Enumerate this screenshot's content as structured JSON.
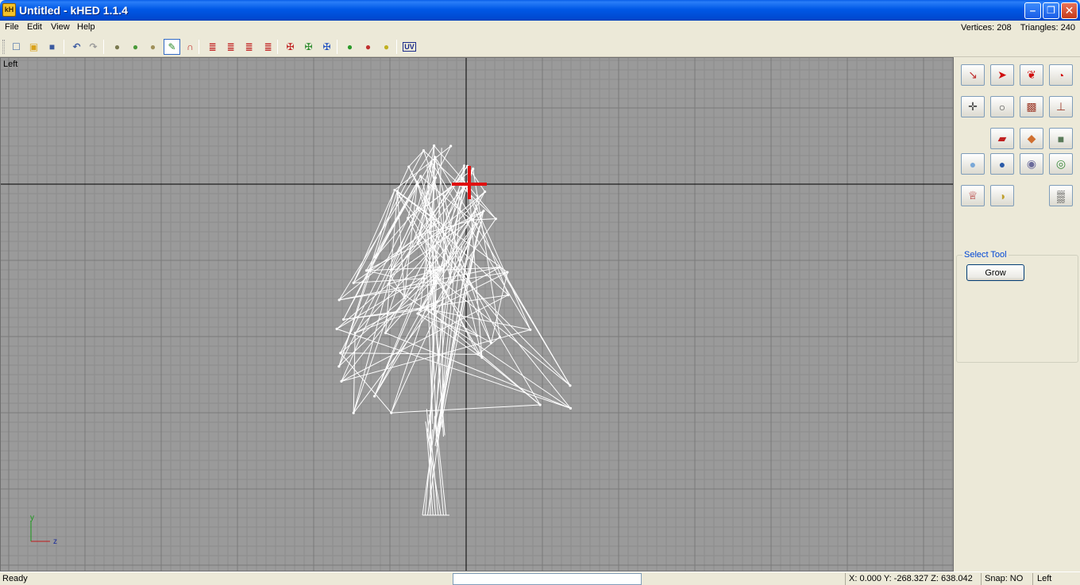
{
  "window": {
    "title": "Untitled - kHED 1.1.4",
    "icon_label": "kH",
    "minimize_glyph": "‒",
    "maximize_glyph": "❐",
    "close_glyph": "✕"
  },
  "menu": {
    "items": [
      "File",
      "Edit",
      "View",
      "Help"
    ]
  },
  "stats": {
    "vertices": "Vertices: 208",
    "triangles": "Triangles: 240"
  },
  "toolbar": {
    "buttons": [
      {
        "icon": "new-file-icon",
        "glyph": "☐",
        "color": "#4a6fa8"
      },
      {
        "icon": "open-folder-icon",
        "glyph": "▣",
        "color": "#d9a21b"
      },
      {
        "icon": "save-icon",
        "glyph": "■",
        "color": "#3b5aa0"
      },
      {
        "icon": "undo-icon",
        "glyph": "↶",
        "color": "#3b5aa0"
      },
      {
        "icon": "redo-icon",
        "glyph": "↷",
        "color": "#9a9a9a"
      },
      {
        "icon": "import-icon",
        "glyph": "●",
        "color": "#7a7a50"
      },
      {
        "icon": "export-icon",
        "glyph": "●",
        "color": "#4a9a3a"
      },
      {
        "icon": "merge-icon",
        "glyph": "●",
        "color": "#a0905a"
      },
      {
        "icon": "weld-tool-icon",
        "glyph": "✎",
        "color": "#2a8a2a"
      },
      {
        "icon": "magnet-icon",
        "glyph": "∩",
        "color": "#c02020"
      },
      {
        "icon": "flip-x-icon",
        "glyph": "≣",
        "color": "#c02020"
      },
      {
        "icon": "flip-y-icon",
        "glyph": "≣",
        "color": "#c02020"
      },
      {
        "icon": "flip-z-icon",
        "glyph": "≣",
        "color": "#c02020"
      },
      {
        "icon": "flip-all-icon",
        "glyph": "≣",
        "color": "#c02020"
      },
      {
        "icon": "mirror-x-icon",
        "glyph": "✠",
        "color": "#c02020"
      },
      {
        "icon": "mirror-y-icon",
        "glyph": "✠",
        "color": "#2a8a2a"
      },
      {
        "icon": "mirror-z-icon",
        "glyph": "✠",
        "color": "#2050c0"
      },
      {
        "icon": "add-point-icon",
        "glyph": "●",
        "color": "#2a9a2a"
      },
      {
        "icon": "remove-point-icon",
        "glyph": "●",
        "color": "#c03030"
      },
      {
        "icon": "auto-point-icon",
        "glyph": "●",
        "color": "#c0b020"
      },
      {
        "icon": "uv-editor-icon",
        "glyph": "UV",
        "color": "#1a2a8a"
      }
    ]
  },
  "viewport": {
    "label": "Left",
    "axis_y_label": "y",
    "axis_z_label": "z"
  },
  "tools": {
    "rows": [
      [
        {
          "icon": "select-point-icon",
          "glyph": "↘",
          "color": "#c03030"
        },
        {
          "icon": "select-arrow-icon",
          "glyph": "➤",
          "color": "#d01010"
        },
        {
          "icon": "select-multi-icon",
          "glyph": "❦",
          "color": "#d01010"
        },
        {
          "icon": "select-lasso-icon",
          "glyph": "◔",
          "color": "#d01010"
        }
      ],
      [
        {
          "icon": "move-icon",
          "glyph": "✛",
          "color": "#444444"
        },
        {
          "icon": "rotate-icon",
          "glyph": "○",
          "color": "#444444"
        },
        {
          "icon": "scale-icon",
          "glyph": "▩",
          "color": "#a04030"
        },
        {
          "icon": "extrude-icon",
          "glyph": "⊥",
          "color": "#a04030"
        }
      ],
      [
        {
          "icon": "plane-icon",
          "glyph": "▰",
          "color": "#c02020"
        },
        {
          "icon": "tile-icon",
          "glyph": "◆",
          "color": "#d07030"
        },
        {
          "icon": "cube-icon",
          "glyph": "■",
          "color": "#5a7a5a"
        }
      ],
      [
        {
          "icon": "sphere-icon",
          "glyph": "●",
          "color": "#7aa8d8"
        },
        {
          "icon": "geosphere-icon",
          "glyph": "●",
          "color": "#2a5aa8"
        },
        {
          "icon": "cylinder-icon",
          "glyph": "◉",
          "color": "#6a6a9a"
        },
        {
          "icon": "torus-icon",
          "glyph": "◎",
          "color": "#3a8a3a"
        }
      ],
      [
        {
          "icon": "lathe-icon",
          "glyph": "♕",
          "color": "#b03030"
        },
        {
          "icon": "paint-icon",
          "glyph": "◑",
          "color": "#c0a030"
        },
        {
          "icon": "checker-icon",
          "glyph": "▒",
          "color": "#111111"
        }
      ]
    ]
  },
  "select_tool": {
    "legend": "Select Tool",
    "grow_label": "Grow"
  },
  "status": {
    "ready": "Ready",
    "coords": "X: 0.000 Y: -268.327 Z: 638.042",
    "snap": "Snap: NO",
    "view": "Left"
  }
}
